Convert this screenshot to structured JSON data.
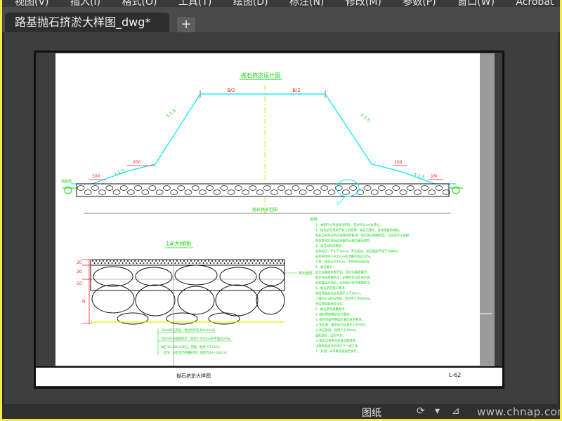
{
  "menubar": {
    "items": [
      "视图(V)",
      "插入(I)",
      "格式(O)",
      "工具(T)",
      "绘图(D)",
      "标注(N)",
      "修改(M)",
      "参数(P)",
      "窗口(W)",
      "Acrobat"
    ]
  },
  "tabs": {
    "active_label": "路基抛石挤淤大样图_dwg*",
    "add_label": "+"
  },
  "drawing": {
    "top_title": "抛石挤淤设计图",
    "dim_b2_left": "B/2",
    "dim_b2_right": "B/2",
    "slope_left": "1:1.5",
    "slope_right": "1:1.5",
    "berm_left": "1:1.5",
    "berm_right": "1:1.5",
    "dim_200_left": "200",
    "dim_200_right": "200",
    "dim_300_left": "300",
    "dim_bottom_right": "1M",
    "ground_label": "地面线",
    "circle_label": "1",
    "base_label": "抛石挤淤范围",
    "detail_title": "1#大样图",
    "detail_dims": [
      "20",
      "30",
      "50",
      "h"
    ],
    "detail_side_label": "碎石垫层",
    "detail_notes": [
      "30cm碎石垫层，粒径控制在40mm以内",
      "50cm片石抛填挤淤（粒径小于30cm的不超过20%）",
      "抛石30~80cm块石，顶面（粒径小于15%）",
      "（含泥、砂砾混合物量控制：面积为30~100cm）"
    ],
    "notes_heading": "说明：",
    "notes": [
      "1、本图尺寸单位除注明外，其余均以cm为单位。",
      "2、抛石挤淤适用于软土层较薄、表层无硬壳、排水困难的地段。",
      "   抛石自中部开始向两侧逐步推进，使淤泥向两侧挤出，石块应大小搭配。",
      "   抛石挤淤完成后应用重型压路机碾压密实。",
      "3、抛石材料的要求：",
      "   石料粒径：不小于30cm，不宜风化，抗压强度不低于30MPa。",
      "   石料中粒径小于15cm的含量不超过20%。",
      "   片石：粒径大于15cm，不得含有风化石。",
      "4、抛石施工：",
      "   应先从路堤中部开始，逐次向两侧展开，",
      "   使淤泥向两侧挤出，必要时可设反压护道，",
      "   抛石露出水面后，应用较小石块填塞垫平。",
      "5、抛石挤淤施工要求：",
      "   抛石顶面高出淤泥面不小于50cm，",
      "   上铺30cm碎石垫层，粒径不大于40mm，",
      "   分层填筑路堤并压实。",
      "6、抛石挤淤质量要求：",
      "   ① 抛石厚度满足设计要求；",
      "   ② 抛石顶面平整度应满足规范要求；",
      "   ③ 压实度：重型压实标准不小于93%；",
      "   ④ 碎石垫层：粒径小于40mm，",
      "      级配良好，压实均匀。",
      "   ⑤ 施工过程中应加强沉降观测，",
      "      沉降稳定后方可进行下一道工序。",
      "7、其他：未尽事宜按规范执行。"
    ],
    "titleblock_name": "抛石挤淤大样图",
    "titleblock_number": "L-62"
  },
  "statusbar": {
    "layout_label": "图纸",
    "watermark": "www.chnap.com"
  },
  "colors": {
    "accent_cyan": "#00e5ff",
    "accent_red": "#ff2020",
    "accent_green": "#12d312",
    "accent_yellow": "#e8e800",
    "frame_dark": "#404040",
    "outer_yellow": "#f2e94a"
  }
}
